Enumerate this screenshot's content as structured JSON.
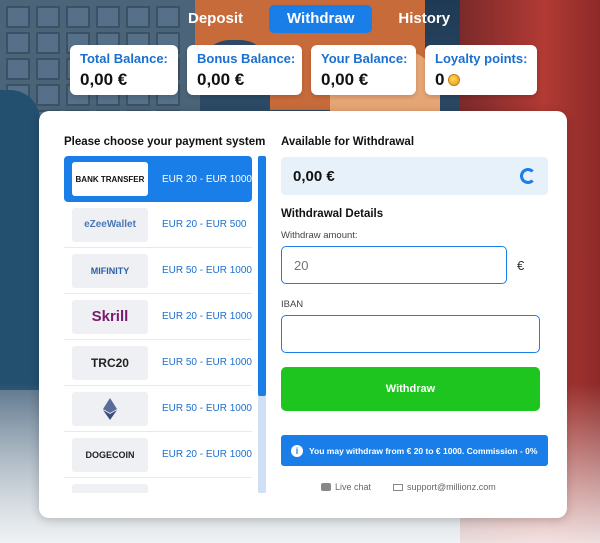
{
  "tabs": [
    {
      "label": "Deposit",
      "active": false
    },
    {
      "label": "Withdraw",
      "active": true
    },
    {
      "label": "History",
      "active": false
    }
  ],
  "balances": [
    {
      "label": "Total Balance:",
      "value": "0,00 €"
    },
    {
      "label": "Bonus Balance:",
      "value": "0,00 €"
    },
    {
      "label": "Your Balance:",
      "value": "0,00 €"
    },
    {
      "label": "Loyalty points:",
      "value": "0"
    }
  ],
  "payment": {
    "title": "Please choose your payment system",
    "methods": [
      {
        "name": "BANK TRANSFER",
        "range": "EUR 20 - EUR 1000",
        "selected": true
      },
      {
        "name": "eZeeWallet",
        "range": "EUR 20 - EUR 500",
        "selected": false
      },
      {
        "name": "MIFINITY",
        "range": "EUR 50 - EUR 1000",
        "selected": false
      },
      {
        "name": "Skrill",
        "range": "EUR 20 - EUR 1000",
        "selected": false
      },
      {
        "name": "TRC20",
        "range": "EUR 50 - EUR 1000",
        "selected": false
      },
      {
        "name": "",
        "range": "EUR 50 - EUR 1000",
        "selected": false
      },
      {
        "name": "DOGECOIN",
        "range": "EUR 20 - EUR 1000",
        "selected": false
      }
    ]
  },
  "withdrawal": {
    "available_title": "Available for Withdrawal",
    "available_amount": "0,00 €",
    "details_title": "Withdrawal Details",
    "amount_label": "Withdraw amount:",
    "amount_placeholder": "20",
    "currency": "€",
    "iban_label": "IBAN",
    "button_label": "Withdraw",
    "info_text": "You may withdraw from € 20 to € 1000. Commission - 0%"
  },
  "footer": {
    "live_chat": "Live chat",
    "email": "support@millionz.com"
  },
  "colors": {
    "accent": "#1a7ee8",
    "button": "#1fc51f"
  }
}
